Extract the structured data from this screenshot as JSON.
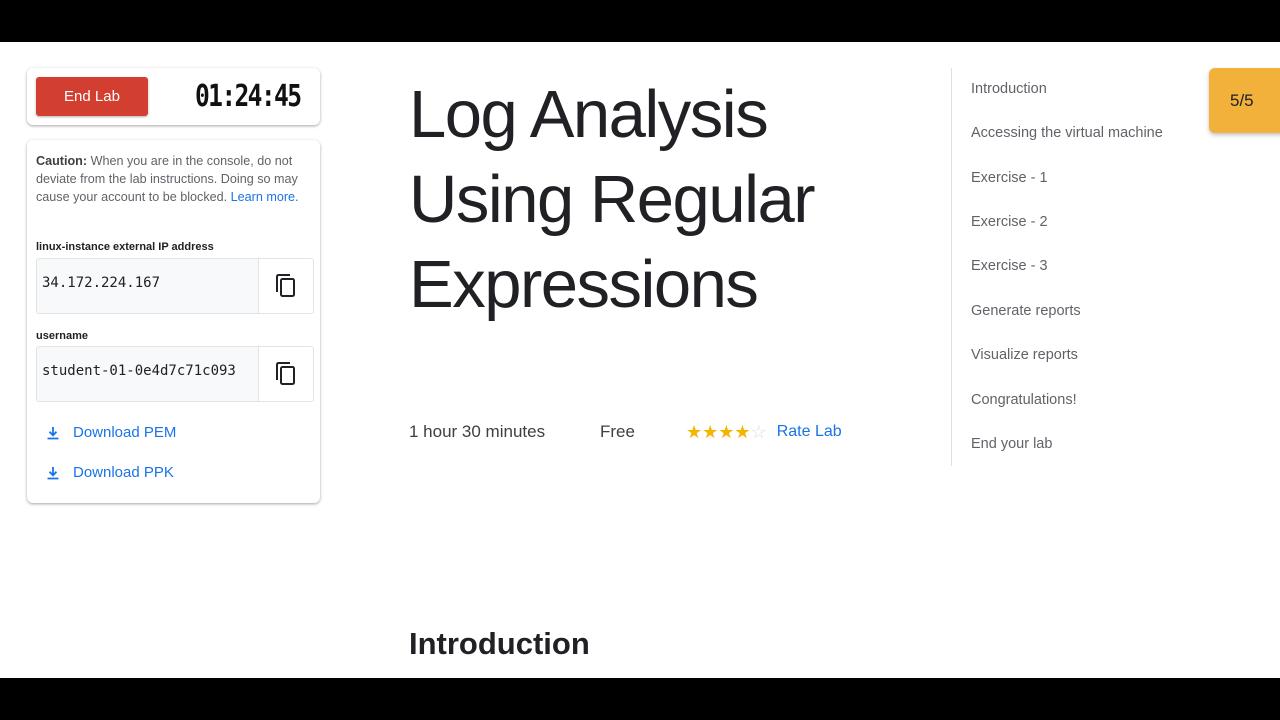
{
  "lab_panel": {
    "end_button_label": "End Lab",
    "timer": "01:24:45",
    "caution_label": "Caution:",
    "caution_text": " When you are in the console, do not deviate from the lab instructions. Doing so may cause your account to be blocked. ",
    "learn_more": "Learn more.",
    "fields": [
      {
        "label": "linux-instance external IP address",
        "value": "34.172.224.167",
        "icon": "copy-icon"
      },
      {
        "label": "username",
        "value": "student-01-0e4d7c71c093",
        "icon": "copy-icon"
      }
    ],
    "downloads": [
      {
        "label": "Download PEM",
        "icon": "download-icon"
      },
      {
        "label": "Download PPK",
        "icon": "download-icon"
      }
    ]
  },
  "lab": {
    "title_lines": [
      "Log Analysis",
      "Using Regular",
      "Expressions"
    ],
    "duration": "1 hour 30 minutes",
    "price": "Free",
    "rating": 4,
    "rating_max": 5,
    "rate_label": "Rate Lab",
    "section_heading": "Introduction"
  },
  "toc": {
    "items": [
      "Introduction",
      "Accessing the virtual machine",
      "Exercise - 1",
      "Exercise - 2",
      "Exercise - 3",
      "Generate reports",
      "Visualize reports",
      "Congratulations!",
      "End your lab"
    ]
  },
  "progress": {
    "label": "5/5"
  },
  "colors": {
    "end_button": "#d23f31",
    "link": "#1a73e8",
    "badge": "#f2b13a",
    "star": "#f4b400"
  }
}
